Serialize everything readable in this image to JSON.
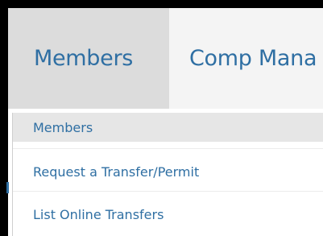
{
  "nav": {
    "tabs": [
      {
        "label": "Members"
      },
      {
        "label": "Comp Mana"
      }
    ]
  },
  "dropdown": {
    "items": [
      {
        "label": "Members"
      },
      {
        "label": "Request a Transfer/Permit"
      },
      {
        "label": "List Online Transfers"
      }
    ]
  },
  "colors": {
    "link": "#2f6fa3",
    "active_tab_bg": "#dcdcdc",
    "nav_bg": "#f4f4f4",
    "selected_item_bg": "#e6e6e6",
    "frame": "#000000"
  }
}
